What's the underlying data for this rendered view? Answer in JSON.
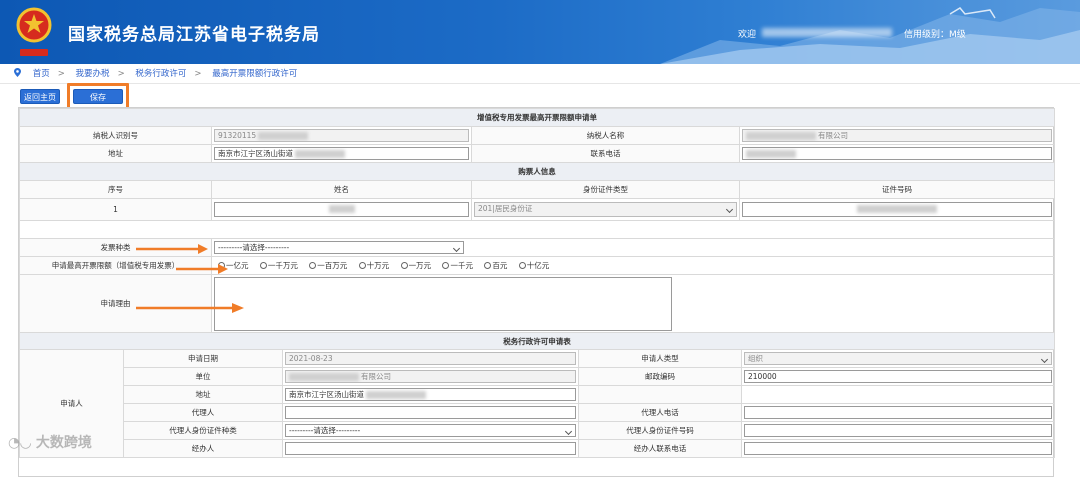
{
  "header": {
    "title": "国家税务总局江苏省电子税务局",
    "welcome": "欢迎",
    "credit": "信用级别：M级"
  },
  "breadcrumb": [
    "首页",
    "我要办税",
    "税务行政许可",
    "最高开票限额行政许可"
  ],
  "buttons": {
    "home": "返回主页",
    "save": "保存"
  },
  "form": {
    "title": "增值税专用发票最高开票限额申请单",
    "taxpayer_id_label": "纳税人识别号",
    "taxpayer_id": "91320115",
    "taxpayer_name_label": "纳税人名称",
    "taxpayer_name": "有限公司",
    "address_label": "地址",
    "address": "南京市江宁区汤山街道",
    "phone_label": "联系电话",
    "buyer_section": "购票人信息",
    "cols": [
      "序号",
      "姓名",
      "身份证件类型",
      "证件号码"
    ],
    "row_no": "1",
    "id_type": "201|居民身份证",
    "invoice_type_label": "发票种类",
    "invoice_type_value": "---------请选择---------",
    "limit_label": "申请最高开票限额（增值税专用发票）",
    "limits": [
      "一亿元",
      "一千万元",
      "一百万元",
      "十万元",
      "一万元",
      "一千元",
      "百元",
      "十亿元"
    ],
    "reason_label": "申请理由"
  },
  "permit": {
    "title": "税务行政许可申请表",
    "applicant": "申请人",
    "date_label": "申请日期",
    "date": "2021-08-23",
    "applicant_type_label": "申请人类型",
    "applicant_type": "组织",
    "unit_label": "单位",
    "unit": "有限公司",
    "postcode_label": "邮政编码",
    "postcode": "210000",
    "address_label": "地址",
    "address": "南京市江宁区汤山街道",
    "agent_label": "代理人",
    "agent_phone_label": "代理人电话",
    "agent_id_type_label": "代理人身份证件种类",
    "agent_id_type": "---------请选择---------",
    "agent_id_no_label": "代理人身份证件号码",
    "handler_label": "经办人",
    "handler_phone_label": "经办人联系电话"
  },
  "watermark": "大数跨境",
  "colors": {
    "banner": "#1c6bc6",
    "accent": "#2b6fd6",
    "highlight": "#f07c28"
  }
}
